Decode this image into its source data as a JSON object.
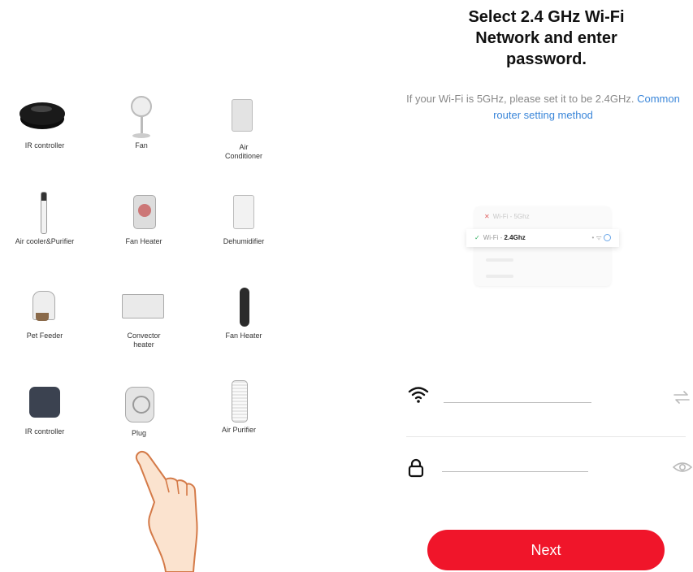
{
  "device_grid": [
    {
      "label": "IR controller",
      "icon": "ir-controller-round-icon"
    },
    {
      "label": "Fan",
      "icon": "fan-icon"
    },
    {
      "label": "Air\nConditioner",
      "icon": "air-conditioner-icon"
    },
    {
      "label": "Air cooler&Purifier",
      "icon": "air-cooler-purifier-icon"
    },
    {
      "label": "Fan Heater",
      "icon": "fan-heater-icon"
    },
    {
      "label": "Dehumidifier",
      "icon": "dehumidifier-icon"
    },
    {
      "label": "Pet Feeder",
      "icon": "pet-feeder-icon"
    },
    {
      "label": "Convector\nheater",
      "icon": "convector-heater-icon"
    },
    {
      "label": "Fan Heater",
      "icon": "tower-fan-heater-icon"
    },
    {
      "label": "IR controller",
      "icon": "ir-controller-square-icon"
    },
    {
      "label": "Plug",
      "icon": "plug-icon"
    },
    {
      "label": "Air Purifier",
      "icon": "air-purifier-icon"
    }
  ],
  "wifi_setup": {
    "title": "Select 2.4 GHz Wi-Fi\nNetwork and enter\npassword.",
    "hint_text": "If your Wi-Fi is 5GHz, please set it to be 2.4GHz.",
    "hint_link": "Common router setting method",
    "illustration": {
      "row_5g_prefix": "Wi-Fi - ",
      "row_5g_band": "5Ghz",
      "row_24g_prefix": "Wi-Fi - ",
      "row_24g_band": "2.4Ghz"
    },
    "network_field_value": "",
    "password_field_value": "",
    "next_label": "Next"
  },
  "colors": {
    "accent_red": "#f0152a",
    "link_blue": "#3a86d9"
  }
}
